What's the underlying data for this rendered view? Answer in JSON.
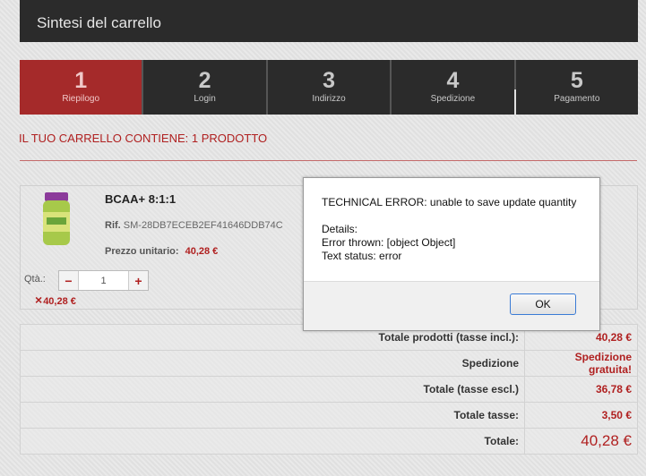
{
  "header": {
    "title": "Sintesi del carrello"
  },
  "steps": [
    {
      "num": "1",
      "label": "Riepilogo"
    },
    {
      "num": "2",
      "label": "Login"
    },
    {
      "num": "3",
      "label": "Indirizzo"
    },
    {
      "num": "4",
      "label": "Spedizione"
    },
    {
      "num": "5",
      "label": "Pagamento"
    }
  ],
  "cart": {
    "count_text": "IL TUO CARRELLO CONTIENE: 1 PRODOTTO"
  },
  "product": {
    "name": "BCAA+ 8:1:1",
    "ref_label": "Rif.",
    "ref_value": "SM-28DB7ECEB2EF41646DDB74C",
    "price_label": "Prezzo unitario:",
    "price_value": "40,28 €",
    "qty_label": "Qtà.:",
    "qty_value": "1",
    "minus": "−",
    "plus": "+",
    "line_total": "40,28 €",
    "remove_icon": "×"
  },
  "summary": [
    {
      "label": "Totale prodotti (tasse incl.):",
      "value": "40,28 €"
    },
    {
      "label": "Spedizione",
      "value": "Spedizione gratuita!"
    },
    {
      "label": "Totale (tasse escl.)",
      "value": "36,78 €"
    },
    {
      "label": "Totale tasse:",
      "value": "3,50 €"
    },
    {
      "label": "Totale:",
      "value": "40,28 €"
    }
  ],
  "dialog": {
    "line1": "TECHNICAL ERROR: unable to save update quantity",
    "line2": "Details:",
    "line3": "Error thrown: [object Object]",
    "line4": "Text status: error",
    "ok": "OK"
  },
  "colors": {
    "accent": "#a52a2a",
    "dark": "#2b2b2b",
    "price": "#b02020"
  }
}
